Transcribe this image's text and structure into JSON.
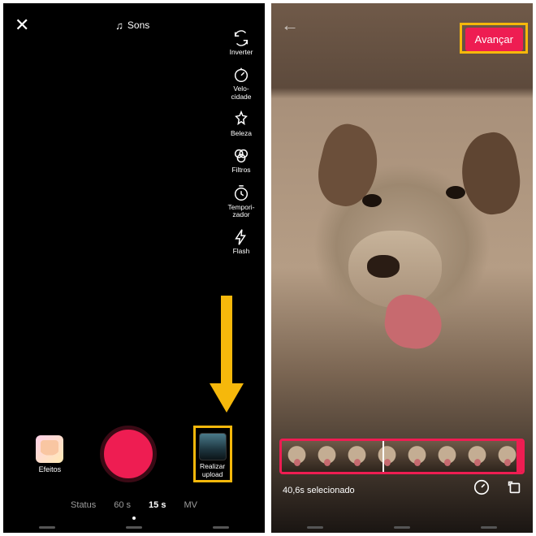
{
  "left": {
    "sounds_label": "Sons",
    "tools": {
      "flip": "Inverter",
      "speed": "Velo-\ncidade",
      "beauty": "Beleza",
      "filters": "Filtros",
      "timer": "Tempori-\nzador",
      "flash": "Flash"
    },
    "effects_label": "Efeitos",
    "upload_label": "Realizar\nupload",
    "modes": {
      "status": "Status",
      "sixty": "60 s",
      "fifteen": "15 s",
      "mv": "MV"
    },
    "active_mode": "fifteen"
  },
  "right": {
    "next_label": "Avançar",
    "selected_label": "40,6s selecionado"
  },
  "annotation": {
    "highlight_color": "#f6b80b",
    "accent_color": "#ee1d52"
  }
}
